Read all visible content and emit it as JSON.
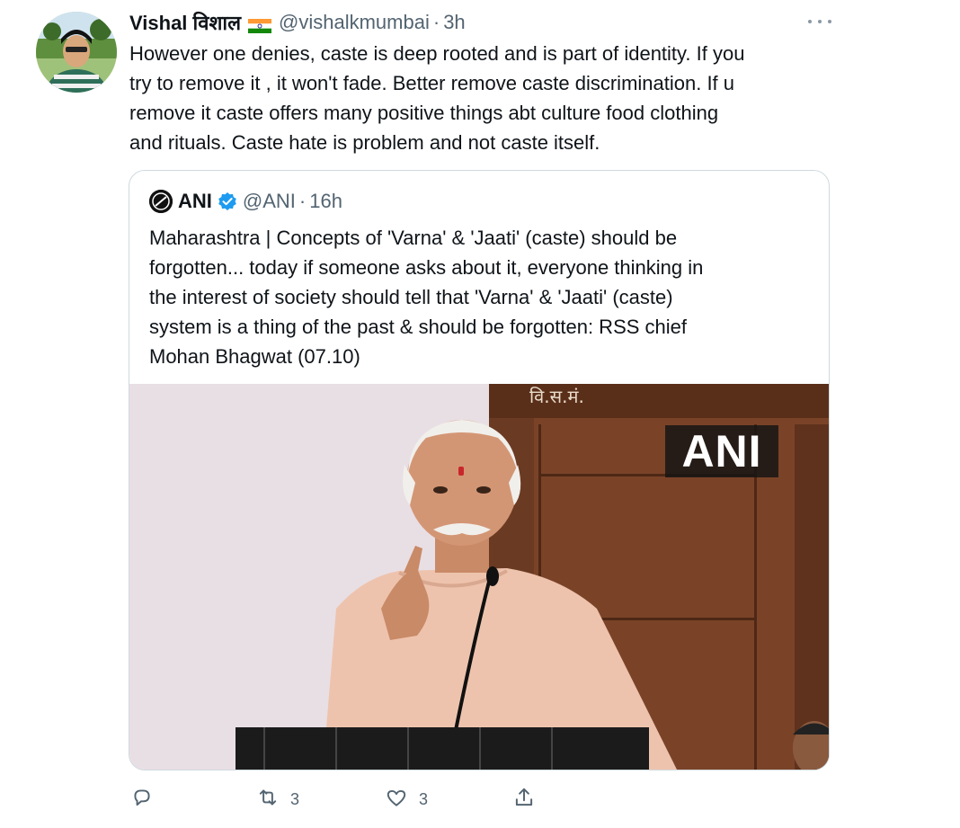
{
  "author": {
    "name": "Vishal विशाल",
    "flag_icon": "india-flag-icon",
    "handle": "@vishalkmumbai",
    "separator": "·",
    "time": "3h"
  },
  "tweet_lines": [
    "However one denies, caste is deep rooted and is part of identity. If you",
    "try to remove it , it won't fade. Better remove caste discrimination. If u",
    "remove it caste offers many positive things abt culture food clothing",
    "and rituals. Caste hate is problem and not caste itself."
  ],
  "quote": {
    "name": "ANI",
    "handle": "@ANI",
    "separator": "·",
    "time": "16h",
    "verified_icon": "verified-badge-icon",
    "text_lines": [
      "Maharashtra | Concepts of 'Varna' & 'Jaati' (caste) should be",
      "forgotten... today if someone asks about it, everyone thinking in",
      "the interest of society should tell that 'Varna' & 'Jaati' (caste)",
      "system is a thing of the past & should be forgotten: RSS chief",
      "Mohan Bhagwat (07.10)"
    ],
    "media": {
      "watermark": "ANI",
      "board_text": "वि.स.मं."
    }
  },
  "actions": {
    "reply_count": "",
    "retweet_count": "3",
    "like_count": "3",
    "share_count": ""
  },
  "colors": {
    "text": "#0f1419",
    "secondary": "#536471",
    "border": "#cfd9de",
    "verified": "#1d9bf0"
  }
}
